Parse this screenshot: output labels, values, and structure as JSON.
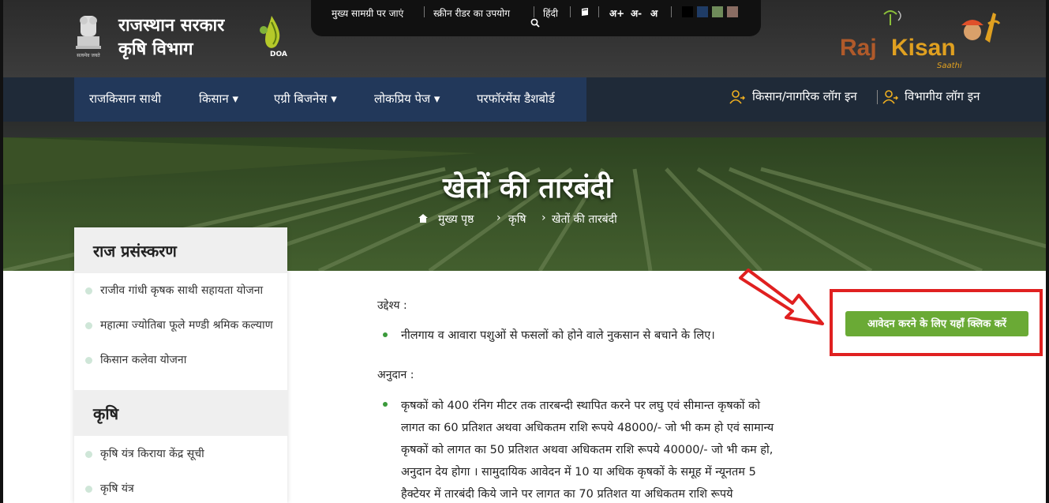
{
  "header": {
    "title_line1": "राजस्थान सरकार",
    "title_line2": "कृषि विभाग",
    "doa_label": "DOA",
    "topbar": {
      "skip": "मुख्य सामग्री पर जाएं",
      "screen_reader": "स्क्रीन रीडर का उपयोग",
      "hindi": "हिंदी",
      "font_plus": "अ+",
      "font_minus": "अ-",
      "font_normal": "अ",
      "themes": [
        "#000000",
        "#1f3c66",
        "#6f8b5a",
        "#8a6d63"
      ]
    },
    "rajkisan_logo": {
      "part1": "Raj",
      "part2": "Kisan",
      "part3": "Saathi"
    }
  },
  "nav": {
    "items": [
      "राजकिसान साथी",
      "किसान ▾",
      "एग्री बिजनेस ▾",
      "लोकप्रिय पेज ▾",
      "परफॉरमेंस डैशबोर्ड"
    ],
    "login_farmer": "किसान/नागरिक लॉग इन",
    "login_dept": "विभागीय लॉग इन"
  },
  "hero": {
    "title": "खेतों की तारबंदी",
    "breadcrumb": [
      "मुख्य पृष्ठ",
      "कृषि",
      "खेतों की तारबंदी"
    ]
  },
  "sidebar": {
    "sections": [
      {
        "heading": "राज प्रसंस्करण",
        "items": [
          "राजीव गांधी कृषक साथी सहायता योजना",
          "महात्मा ज्योतिबा फूले मण्डी श्रमिक कल्याण",
          "किसान कलेवा योजना"
        ]
      },
      {
        "heading": "कृषि",
        "items": [
          "कृषि यंत्र किराया केंद्र सूची",
          "कृषि यंत्र"
        ]
      }
    ]
  },
  "content": {
    "objective_heading": "उद्देश्य :",
    "objective_text": "नीलगाय व आवारा पशुओं से फसलों को होने वाले नुकसान से बचाने के लिए।",
    "grant_heading": "अनुदान :",
    "grant_lines": [
      "कृषकों को 400 रंनिग मीटर तक तारबन्दी स्थापित करने पर लघु एवं सीमान्त कृषकों को",
      "लागत का 60 प्रतिशत अथवा अधिकतम राशि रूपये 48000/- जो भी कम हो एवं सामान्य",
      "कृषकों को लागत का 50 प्रतिशत अथवा अधिकतम राशि रूपये 40000/- जो भी कम हो,",
      "अनुदान देय होगा । सामुदायिक आवेदन में 10 या अधिक कृषकों के समूह में न्यूनतम 5",
      "हैक्टेयर में तारबंदी किये जाने पर लागत का 70 प्रतिशत या अधिकतम राशि रूपये"
    ],
    "apply_button": "आवेदन करने के लिए यहाँ क्लिक करें"
  },
  "colors": {
    "nav_bg": "#22385a",
    "apply_green": "#6aaa35",
    "highlight_red": "#e02020"
  }
}
